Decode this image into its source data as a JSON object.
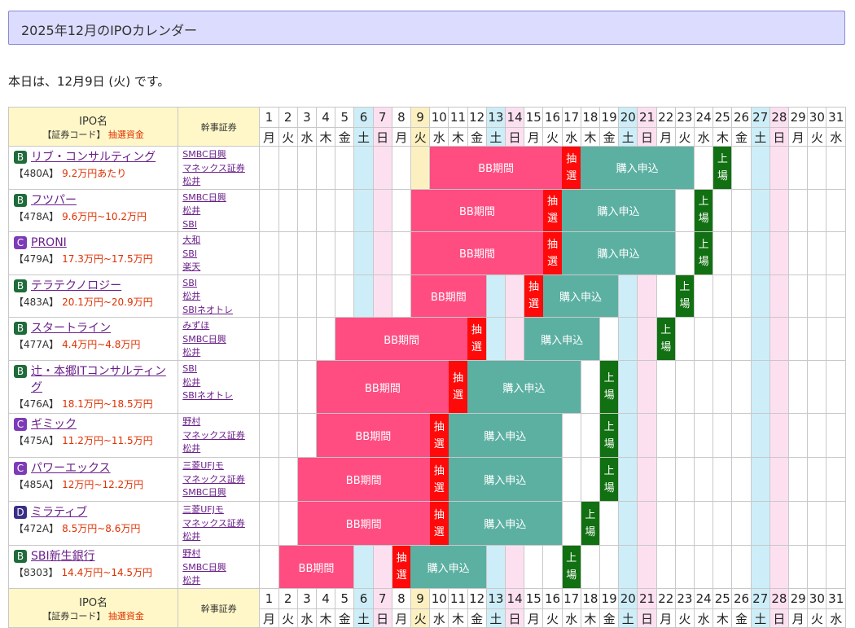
{
  "title": "2025年12月のIPOカレンダー",
  "today_text": "本日は、12月9日 (火) です。",
  "table_header": {
    "ipo_name": "IPO名",
    "code_label": "【証券コード】",
    "funds_label": "抽選資金",
    "broker_label": "幹事証券"
  },
  "days": [
    "1",
    "2",
    "3",
    "4",
    "5",
    "6",
    "7",
    "8",
    "9",
    "10",
    "11",
    "12",
    "13",
    "14",
    "15",
    "16",
    "17",
    "18",
    "19",
    "20",
    "21",
    "22",
    "23",
    "24",
    "25",
    "26",
    "27",
    "28",
    "29",
    "30",
    "31"
  ],
  "weekdays": [
    "月",
    "火",
    "水",
    "木",
    "金",
    "土",
    "日",
    "月",
    "火",
    "水",
    "木",
    "金",
    "土",
    "日",
    "月",
    "火",
    "水",
    "木",
    "金",
    "土",
    "日",
    "月",
    "火",
    "水",
    "木",
    "金",
    "土",
    "日",
    "月",
    "火",
    "水"
  ],
  "sat_days": [
    6,
    13,
    20,
    27
  ],
  "sun_days": [
    7,
    14,
    21,
    28
  ],
  "today_day": 9,
  "labels": {
    "bb": "BB期間",
    "lottery": "抽選",
    "buy": "購入申込",
    "listing": "上場"
  },
  "colors": {
    "bb": "#ff4d82",
    "lottery": "#ff0a0a",
    "buy": "#5cb0a2",
    "listing": "#117011",
    "saturday": "#cdeef8",
    "sunday": "#fde0f0",
    "today": "#fdf0c0"
  },
  "ipos": [
    {
      "rank": "B",
      "name": "リブ・コンサルティング",
      "code": "【480A】",
      "price": "9.2万円あたり",
      "brokers": [
        "SMBC日興",
        "マネックス証券",
        "松井"
      ],
      "bb_start": 10,
      "bb_end": 16,
      "lottery": 17,
      "buy_start": 18,
      "buy_end": 23,
      "listing": 25
    },
    {
      "rank": "B",
      "name": "フツパー",
      "code": "【478A】",
      "price": "9.6万円~10.2万円",
      "brokers": [
        "SMBC日興",
        "松井",
        "SBI"
      ],
      "bb_start": 9,
      "bb_end": 15,
      "lottery": 16,
      "buy_start": 17,
      "buy_end": 22,
      "listing": 24
    },
    {
      "rank": "C",
      "name": "PRONI",
      "code": "【479A】",
      "price": "17.3万円~17.5万円",
      "brokers": [
        "大和",
        "SBI",
        "楽天"
      ],
      "bb_start": 9,
      "bb_end": 15,
      "lottery": 16,
      "buy_start": 17,
      "buy_end": 22,
      "listing": 24
    },
    {
      "rank": "B",
      "name": "テラテクノロジー",
      "code": "【483A】",
      "price": "20.1万円~20.9万円",
      "brokers": [
        "SBI",
        "松井",
        "SBIネオトレ"
      ],
      "bb_start": 9,
      "bb_end": 12,
      "lottery": 15,
      "buy_start": 16,
      "buy_end": 19,
      "listing": 23
    },
    {
      "rank": "B",
      "name": "スタートライン",
      "code": "【477A】",
      "price": "4.4万円~4.8万円",
      "brokers": [
        "みずほ",
        "SMBC日興",
        "松井"
      ],
      "bb_start": 5,
      "bb_end": 11,
      "lottery": 12,
      "buy_start": 15,
      "buy_end": 18,
      "listing": 22
    },
    {
      "rank": "B",
      "name": "辻・本郷ITコンサルティング",
      "code": "【476A】",
      "price": "18.1万円~18.5万円",
      "brokers": [
        "SBI",
        "松井",
        "SBIネオトレ"
      ],
      "bb_start": 4,
      "bb_end": 10,
      "lottery": 11,
      "buy_start": 12,
      "buy_end": 17,
      "listing": 19
    },
    {
      "rank": "C",
      "name": "ギミック",
      "code": "【475A】",
      "price": "11.2万円~11.5万円",
      "brokers": [
        "野村",
        "マネックス証券",
        "松井"
      ],
      "bb_start": 4,
      "bb_end": 9,
      "lottery": 10,
      "buy_start": 11,
      "buy_end": 16,
      "listing": 19
    },
    {
      "rank": "C",
      "name": "パワーエックス",
      "code": "【485A】",
      "price": "12万円~12.2万円",
      "brokers": [
        "三菱UFJモ",
        "マネックス証券",
        "SMBC日興"
      ],
      "bb_start": 3,
      "bb_end": 9,
      "lottery": 10,
      "buy_start": 11,
      "buy_end": 16,
      "listing": 19
    },
    {
      "rank": "D",
      "name": "ミラティブ",
      "code": "【472A】",
      "price": "8.5万円~8.6万円",
      "brokers": [
        "三菱UFJモ",
        "マネックス証券",
        "松井"
      ],
      "bb_start": 3,
      "bb_end": 9,
      "lottery": 10,
      "buy_start": 11,
      "buy_end": 16,
      "listing": 18
    },
    {
      "rank": "B",
      "name": "SBI新生銀行",
      "code": "【8303】",
      "price": "14.4万円~14.5万円",
      "brokers": [
        "野村",
        "SMBC日興",
        "松井"
      ],
      "bb_start": 2,
      "bb_end": 5,
      "lottery": 8,
      "buy_start": 9,
      "buy_end": 12,
      "listing": 17
    }
  ]
}
